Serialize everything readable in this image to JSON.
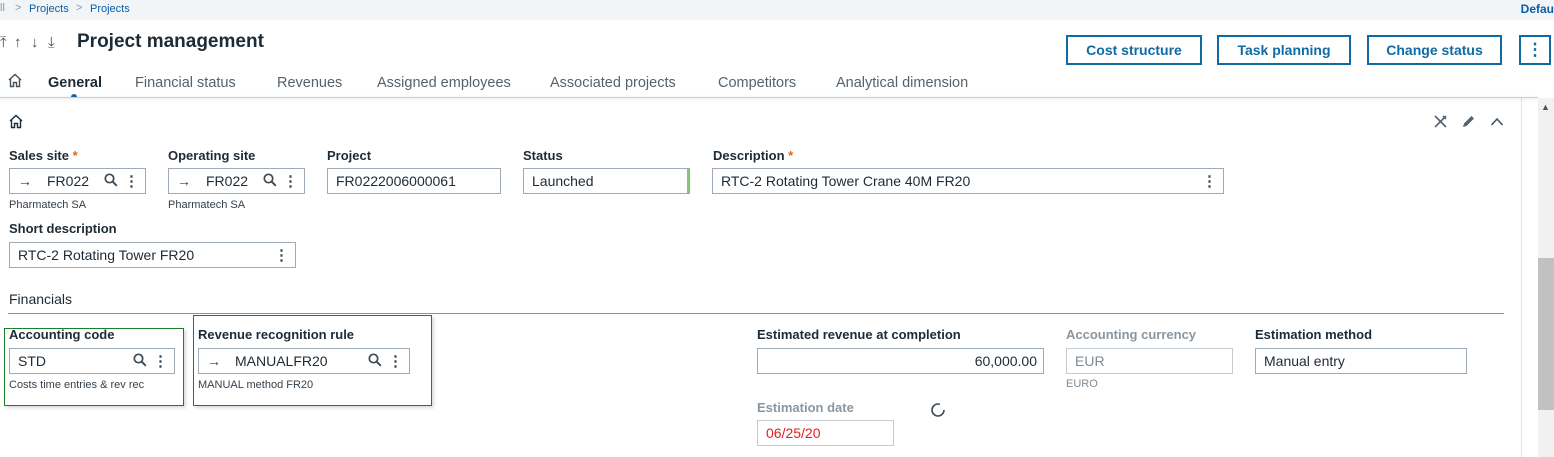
{
  "breadcrumb": {
    "items": [
      "Projects",
      "Projects"
    ],
    "right_link": "Defau"
  },
  "header": {
    "title": "Project management",
    "buttons": {
      "cost_structure": "Cost structure",
      "task_planning": "Task planning",
      "change_status": "Change status",
      "more": "⋮"
    }
  },
  "tabs": [
    "General",
    "Financial status",
    "Revenues",
    "Assigned employees",
    "Associated projects",
    "Competitors",
    "Analytical dimension"
  ],
  "form": {
    "sales_site": {
      "label": "Sales site",
      "value": "FR022",
      "sub": "Pharmatech SA"
    },
    "operating_site": {
      "label": "Operating site",
      "value": "FR022",
      "sub": "Pharmatech SA"
    },
    "project": {
      "label": "Project",
      "value": "FR0222006000061"
    },
    "status": {
      "label": "Status",
      "value": "Launched",
      "color": "#7ecb6f"
    },
    "description": {
      "label": "Description",
      "value": "RTC-2 Rotating Tower Crane 40M FR20"
    },
    "short_description": {
      "label": "Short description",
      "value": "RTC-2 Rotating Tower FR20"
    }
  },
  "financials": {
    "title": "Financials",
    "accounting_code": {
      "label": "Accounting code",
      "value": "STD",
      "sub": "Costs time entries & rev rec"
    },
    "revenue_rule": {
      "label": "Revenue recognition rule",
      "value": "MANUALFR20",
      "sub": "MANUAL method FR20"
    },
    "estimated_revenue": {
      "label": "Estimated revenue at completion",
      "value": "60,000.00"
    },
    "accounting_currency": {
      "label": "Accounting currency",
      "value": "EUR",
      "sub": "EURO"
    },
    "estimation_method": {
      "label": "Estimation method",
      "value": "Manual entry"
    },
    "estimation_date": {
      "label": "Estimation date",
      "value": "06/25/20",
      "color": "#e02020"
    }
  },
  "colors": {
    "accent": "#0f6aa5",
    "highlight_box": "#1a7f2b",
    "required": "#e8650f"
  }
}
